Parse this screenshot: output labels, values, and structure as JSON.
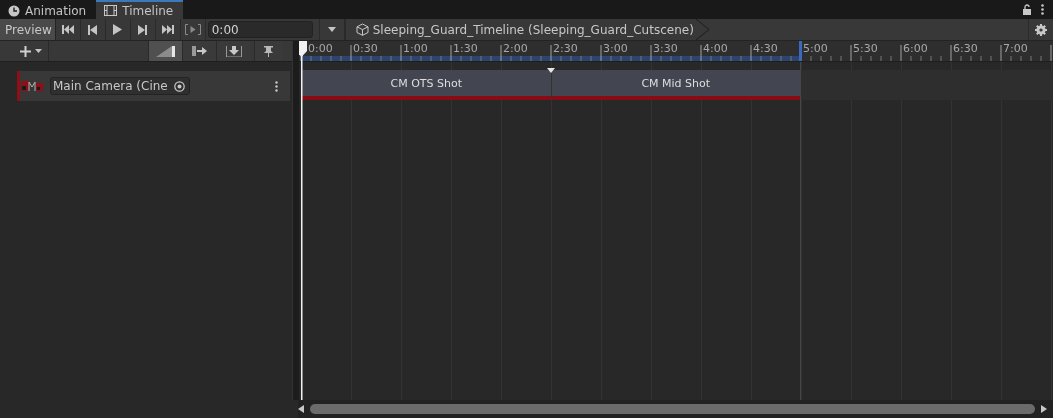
{
  "tabs": [
    {
      "label": "Animation",
      "kind": "animation",
      "selected": false
    },
    {
      "label": "Timeline",
      "kind": "timeline",
      "selected": true
    }
  ],
  "toolbar": {
    "preview": "Preview",
    "frame_field": {
      "value": "0:00"
    },
    "breadcrumb": "Sleeping_Guard_Timeline (Sleeping_Guard_Cutscene)"
  },
  "ruler": {
    "labels": [
      "0:00",
      "0:30",
      "1:00",
      "1:30",
      "2:00",
      "2:30",
      "3:00",
      "3:30",
      "4:00",
      "4:30",
      "5:00",
      "5:30",
      "6:00",
      "6:30",
      "7:00"
    ]
  },
  "tracks": [
    {
      "name": "Main Camera (Cine",
      "clips": [
        {
          "label": "CM OTS Shot"
        },
        {
          "label": "CM Mid Shot"
        }
      ]
    }
  ]
}
